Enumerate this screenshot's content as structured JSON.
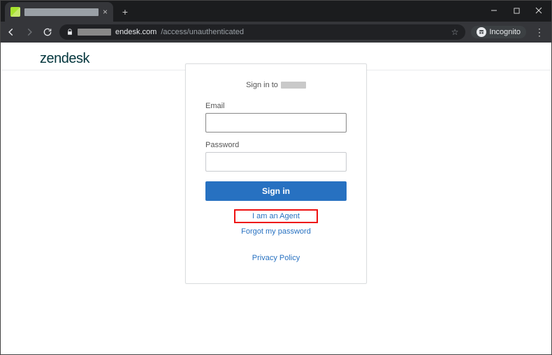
{
  "browser": {
    "url_visible": "endesk.com",
    "url_path": "/access/unauthenticated",
    "incognito_label": "Incognito"
  },
  "page": {
    "brand": "zendesk",
    "signin_prefix": "Sign in to",
    "labels": {
      "email": "Email",
      "password": "Password"
    },
    "buttons": {
      "signin": "Sign in"
    },
    "links": {
      "agent": "I am an Agent",
      "forgot": "Forgot my password",
      "privacy": "Privacy Policy"
    },
    "inputs": {
      "email_value": "",
      "password_value": ""
    }
  }
}
